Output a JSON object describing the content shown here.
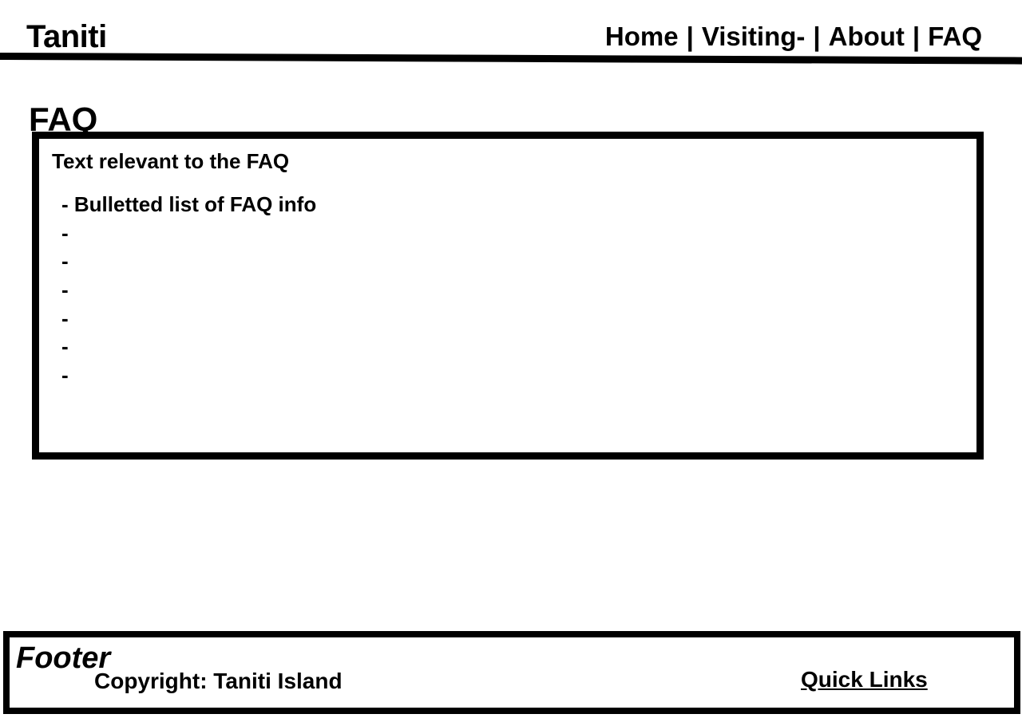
{
  "header": {
    "brand": "Taniti",
    "nav": [
      {
        "label": "Home"
      },
      {
        "label": "Visiting-"
      },
      {
        "label": "About"
      },
      {
        "label": "FAQ"
      }
    ],
    "separator": "|"
  },
  "main": {
    "title": "FAQ",
    "intro": "Text relevant to the FAQ",
    "list_items": [
      "- Bulletted list of FAQ info",
      "-",
      "-",
      "-",
      "-",
      "-",
      "-"
    ]
  },
  "footer": {
    "label": "Footer",
    "copyright": "Copyright: Taniti Island",
    "quick_links": "Quick Links"
  }
}
